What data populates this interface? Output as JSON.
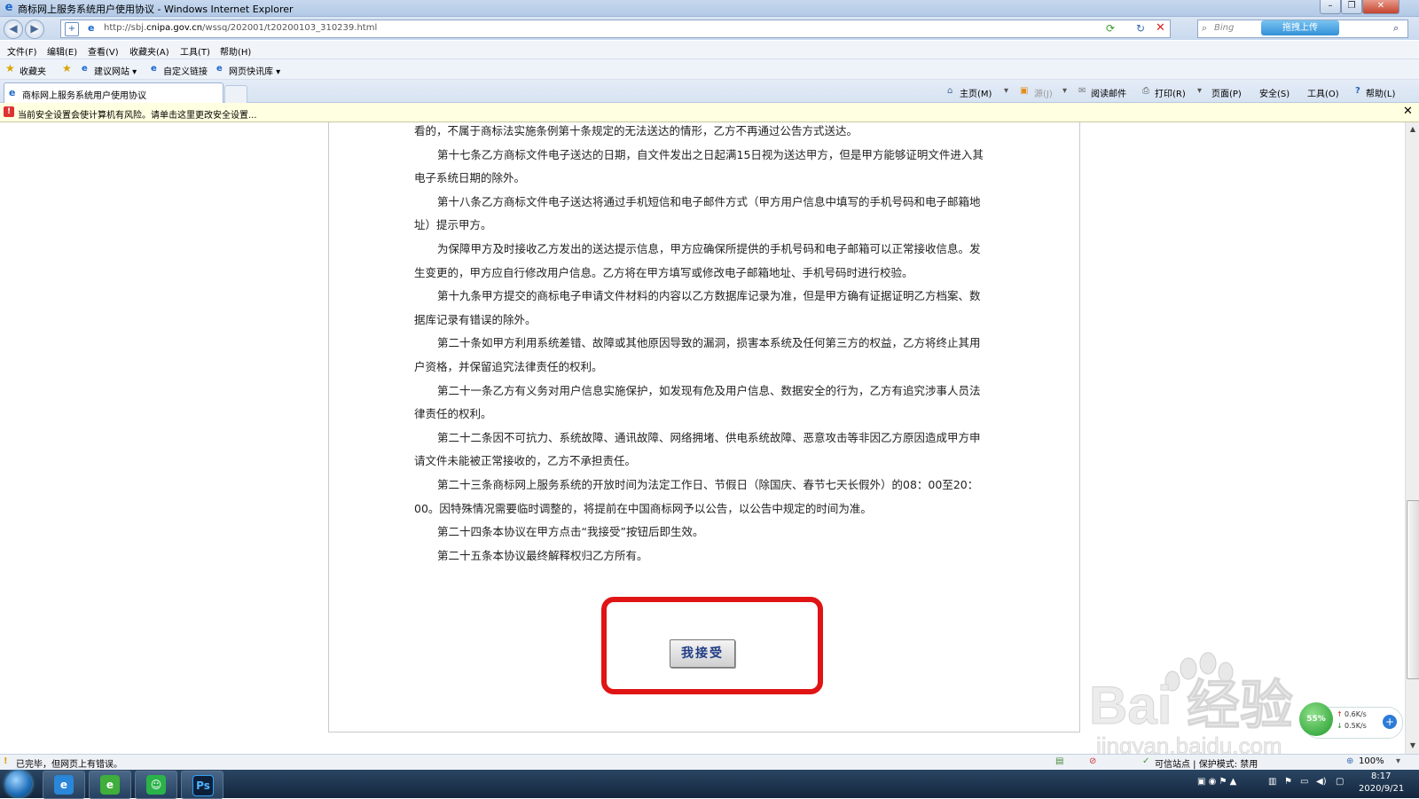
{
  "window": {
    "title": "商标网上服务系统用户使用协议 - Windows Internet Explorer",
    "min_glyph": "–",
    "restore_glyph": "❐",
    "close_glyph": "✕"
  },
  "address_bar": {
    "url_prefix": "http://sbj.",
    "url_domain": "cnipa.gov.cn",
    "url_path": "/wssq/202001/t20200103_310239.html",
    "search_placeholder": "Bing",
    "upload_label": "拖拽上传"
  },
  "menu": [
    "文件(F)",
    "编辑(E)",
    "查看(V)",
    "收藏夹(A)",
    "工具(T)",
    "帮助(H)"
  ],
  "favorites_bar": {
    "favorites_label": "收藏夹",
    "items": [
      "建议网站 ▾",
      "自定义链接",
      "网页快讯库 ▾"
    ]
  },
  "tabs": {
    "active_label": "商标网上服务系统用户使用协议"
  },
  "command_bar": [
    "主页(M)",
    "源(J)",
    "阅读邮件",
    "打印(R)",
    "页面(P)",
    "安全(S)",
    "工具(O)",
    "帮助(L)"
  ],
  "info_bar": {
    "text": "当前安全设置会使计算机有风险。请单击这里更改安全设置..."
  },
  "document": {
    "paragraphs": [
      "看的，不属于商标法实施条例第十条规定的无法送达的情形，乙方不再通过公告方式送达。",
      "第十七条乙方商标文件电子送达的日期，自文件发出之日起满15日视为送达甲方，但是甲方能够证明文件进入其电子系统日期的除外。",
      "第十八条乙方商标文件电子送达将通过手机短信和电子邮件方式（甲方用户信息中填写的手机号码和电子邮箱地址）提示甲方。",
      "为保障甲方及时接收乙方发出的送达提示信息，甲方应确保所提供的手机号码和电子邮箱可以正常接收信息。发生变更的，甲方应自行修改用户信息。乙方将在甲方填写或修改电子邮箱地址、手机号码时进行校验。",
      "第十九条甲方提交的商标电子申请文件材料的内容以乙方数据库记录为准，但是甲方确有证据证明乙方档案、数据库记录有错误的除外。",
      "第二十条如甲方利用系统差错、故障或其他原因导致的漏洞，损害本系统及任何第三方的权益，乙方将终止其用户资格，并保留追究法律责任的权利。",
      "第二十一条乙方有义务对用户信息实施保护，如发现有危及用户信息、数据安全的行为，乙方有追究涉事人员法律责任的权利。",
      "第二十二条因不可抗力、系统故障、通讯故障、网络拥堵、供电系统故障、恶意攻击等非因乙方原因造成甲方申请文件未能被正常接收的，乙方不承担责任。",
      "第二十三条商标网上服务系统的开放时间为法定工作日、节假日（除国庆、春节七天长假外）的08：00至20：00。因特殊情况需要临时调整的，将提前在中国商标网予以公告，以公告中规定的时间为准。",
      "第二十四条本协议在甲方点击“我接受”按钮后即生效。",
      "第二十五条本协议最终解释权归乙方所有。"
    ],
    "accept_button": "我接受"
  },
  "status_bar": {
    "left": "已完毕，但网页上有错误。",
    "zone": "可信站点 | 保护模式: 禁用",
    "zoom": "100%"
  },
  "taskbar": {
    "ps_label": "Ps",
    "time": "8:17",
    "date": "2020/9/21"
  },
  "overlay": {
    "watermark_text": "Bai 经验",
    "watermark_sub": "jingyan.baidu.com",
    "speed_up": "0.6K/s",
    "speed_down": "0.5K/s",
    "speed_percent": "55%"
  },
  "colors": {
    "highlight_border": "#e01414",
    "button_text": "#1f3c86",
    "infobar_bg": "#ffffe1"
  }
}
